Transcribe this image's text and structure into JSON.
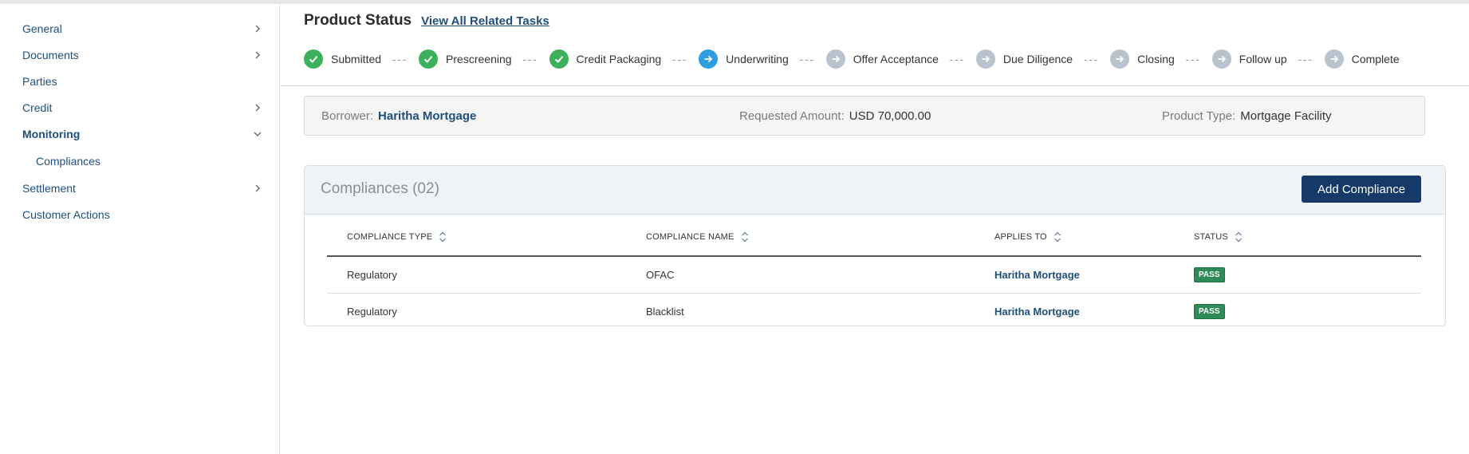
{
  "sidebar": {
    "items": [
      {
        "label": "General",
        "chevron": "right"
      },
      {
        "label": "Documents",
        "chevron": "right"
      },
      {
        "label": "Parties",
        "chevron": "none"
      },
      {
        "label": "Credit",
        "chevron": "right"
      },
      {
        "label": "Monitoring",
        "chevron": "down",
        "active": true
      },
      {
        "label": "Compliances",
        "chevron": "none",
        "sub": true
      },
      {
        "label": "Settlement",
        "chevron": "right"
      },
      {
        "label": "Customer Actions",
        "chevron": "none"
      }
    ]
  },
  "product_status": {
    "title": "Product Status",
    "link": "View All Related Tasks",
    "steps": [
      {
        "label": "Submitted",
        "state": "done"
      },
      {
        "label": "Prescreening",
        "state": "done"
      },
      {
        "label": "Credit Packaging",
        "state": "done"
      },
      {
        "label": "Underwriting",
        "state": "current"
      },
      {
        "label": "Offer Acceptance",
        "state": "todo"
      },
      {
        "label": "Due Diligence",
        "state": "todo"
      },
      {
        "label": "Closing",
        "state": "todo"
      },
      {
        "label": "Follow up",
        "state": "todo"
      },
      {
        "label": "Complete",
        "state": "todo"
      }
    ],
    "separator": "---"
  },
  "summary": {
    "borrower_label": "Borrower:",
    "borrower_value": "Haritha Mortgage",
    "amount_label": "Requested Amount:",
    "amount_value": "USD 70,000.00",
    "type_label": "Product Type:",
    "type_value": "Mortgage Facility"
  },
  "compliances": {
    "title": "Compliances (02)",
    "add_button": "Add Compliance",
    "columns": [
      "COMPLIANCE TYPE",
      "COMPLIANCE NAME",
      "APPLIES TO",
      "STATUS"
    ],
    "rows": [
      {
        "type": "Regulatory",
        "name": "OFAC",
        "applies_to": "Haritha Mortgage",
        "status": "PASS"
      },
      {
        "type": "Regulatory",
        "name": "Blacklist",
        "applies_to": "Haritha Mortgage",
        "status": "PASS"
      }
    ]
  },
  "colors": {
    "primary": "#153a68",
    "link": "#1f4e79",
    "step_done": "#3cb05a",
    "step_current": "#2f9ee0",
    "step_todo": "#b9c3cf",
    "pass_badge": "#2e8b57"
  }
}
